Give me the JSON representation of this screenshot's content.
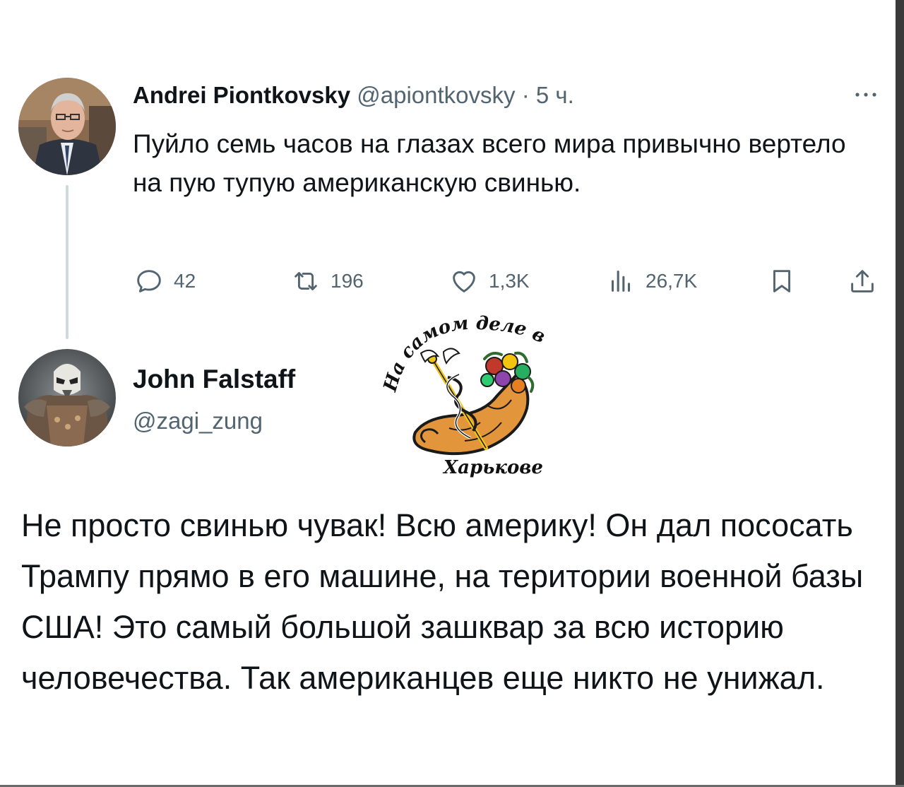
{
  "tweet1": {
    "display_name": "Andrei Piontkovsky",
    "handle": "@apiontkovsky",
    "separator": "·",
    "time": "5 ч.",
    "more_icon": "more-horizontal-icon",
    "text": "Пуйло семь часов на глазах всего мира привычно вертело на пую тупую американскую свинью.",
    "actions": {
      "replies": "42",
      "retweets": "196",
      "likes": "1,3K",
      "views": "26,7K"
    }
  },
  "tweet2": {
    "display_name": "John Falstaff",
    "handle": "@zagi_zung",
    "text": "Не просто свинью чувак! Всю америку! Он дал пососать Трампу прямо в его машине, на територии военной базы США! Это самый большой зашквар за всю историю человечества. Так американцев еще никто не унижал."
  },
  "watermark": {
    "text_top": "На самом деле в",
    "text_bottom": "Харькове"
  },
  "colors": {
    "text": "#0f1419",
    "secondary": "#536471",
    "thread_line": "#cfd9de",
    "cornucopia": "#e3953b",
    "caduceus": "#f0c419"
  }
}
